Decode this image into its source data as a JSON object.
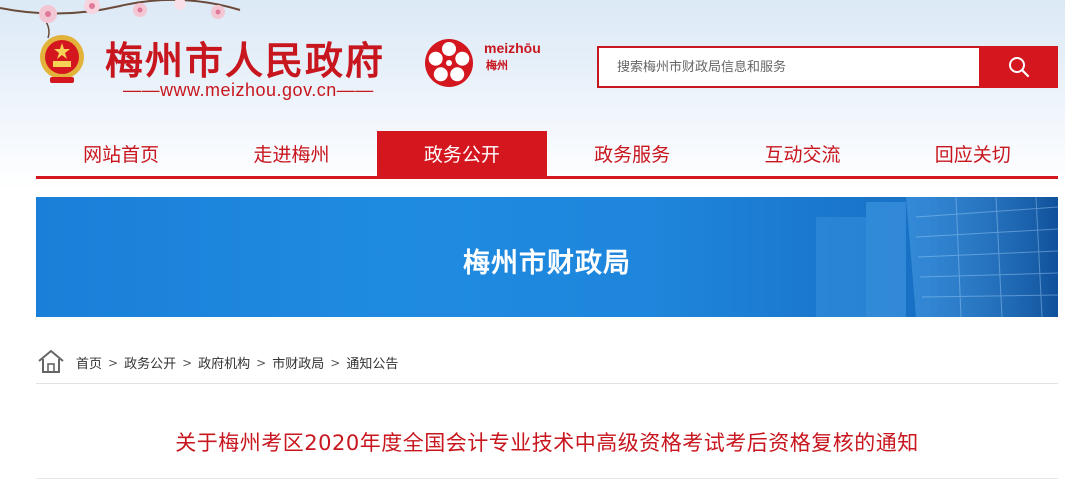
{
  "header": {
    "site_title": "梅州市人民政府",
    "site_url": "——www.meizhou.gov.cn——",
    "city_logo_en": "meizhōu",
    "city_logo_cn": "梅州",
    "accent_color": "#c8161e"
  },
  "search": {
    "placeholder": "搜索梅州市财政局信息和服务",
    "button_icon": "search-icon"
  },
  "nav": {
    "items": [
      {
        "label": "网站首页"
      },
      {
        "label": "走进梅州"
      },
      {
        "label": "政务公开"
      },
      {
        "label": "政务服务"
      },
      {
        "label": "互动交流"
      },
      {
        "label": "回应关切"
      }
    ],
    "active": "政务公开"
  },
  "banner": {
    "title": "梅州市财政局",
    "color": "#1e86dc"
  },
  "breadcrumb": {
    "icon": "home-icon",
    "items": [
      "首页",
      "政务公开",
      "政府机构",
      "市财政局",
      "通知公告"
    ],
    "separator": ">"
  },
  "article": {
    "title": "关于梅州考区2020年度全国会计专业技术中高级资格考试考后资格复核的通知"
  }
}
